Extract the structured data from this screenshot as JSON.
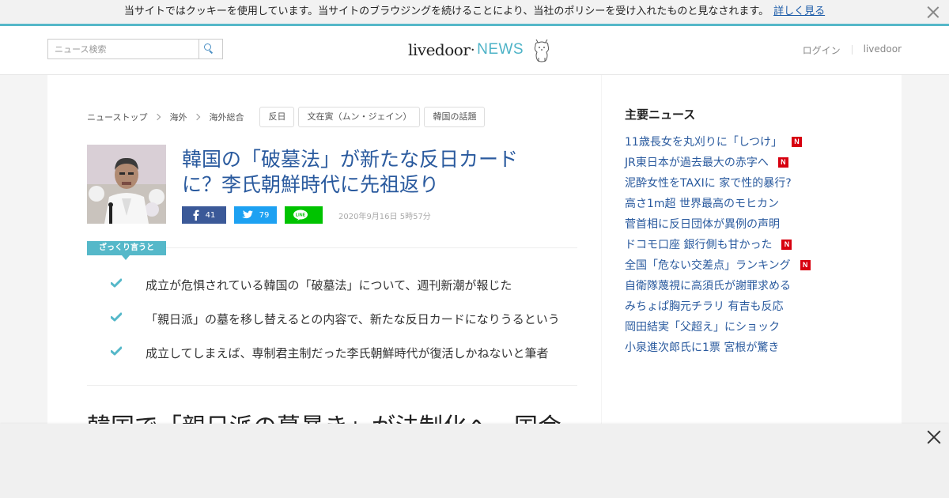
{
  "cookie_bar": {
    "message": "当サイトではクッキーを使用しています。当サイトのブラウジングを続けることにより、当社のポリシーを受け入れたものと見なされます。",
    "link": "詳しく見る"
  },
  "header": {
    "search_placeholder": "ニュース検索",
    "logo_livedoor": "livedoor",
    "logo_news": "NEWS",
    "login": "ログイン",
    "livedoor_link": "livedoor"
  },
  "breadcrumb": [
    "ニューストップ",
    "海外",
    "海外総合"
  ],
  "tags": [
    "反日",
    "文在寅（ムン・ジェイン）",
    "韓国の話題"
  ],
  "article": {
    "title": "韓国の「破墓法」が新たな反日カードに？李氏朝鮮時代に先祖返り",
    "share": {
      "facebook_count": "41",
      "twitter_count": "79",
      "line_label": "LINE"
    },
    "date": "2020年9月16日 5時57分",
    "summary_label": "ざっくり言うと",
    "points": [
      "成立が危惧されている韓国の「破墓法」について、週刊新潮が報じた",
      "「親日派」の墓を移し替えるとの内容で、新たな反日カードになりうるという",
      "成立してしまえば、専制君主制だった李氏朝鮮時代が復活しかねないと筆者"
    ],
    "body_heading": "韓国で「親日派の墓暴き」が法制化へ　国会"
  },
  "sidebar": {
    "title": "主要ニュース",
    "news": [
      {
        "text": "11歳長女を丸刈りに「しつけ」",
        "new": true
      },
      {
        "text": "JR東日本が過去最大の赤字へ",
        "new": true
      },
      {
        "text": "泥酔女性をTAXIに 家で性的暴行?",
        "new": false
      },
      {
        "text": "高さ1m超 世界最高のモヒカン",
        "new": false
      },
      {
        "text": "菅首相に反日団体が異例の声明",
        "new": false
      },
      {
        "text": "ドコモ口座 銀行側も甘かった",
        "new": true
      },
      {
        "text": "全国「危ない交差点」ランキング",
        "new": true
      },
      {
        "text": "自衛隊蔑視に高須氏が謝罪求める",
        "new": false
      },
      {
        "text": "みちょぱ胸元チラリ 有吉も反応",
        "new": false
      },
      {
        "text": "岡田結実「父超え」にショック",
        "new": false
      },
      {
        "text": "小泉進次郎氏に1票 宮根が驚き",
        "new": false
      }
    ],
    "new_badge": "N"
  },
  "colors": {
    "accent": "#55b8c9",
    "link": "#2a5a9e",
    "badge": "#d7000f"
  }
}
